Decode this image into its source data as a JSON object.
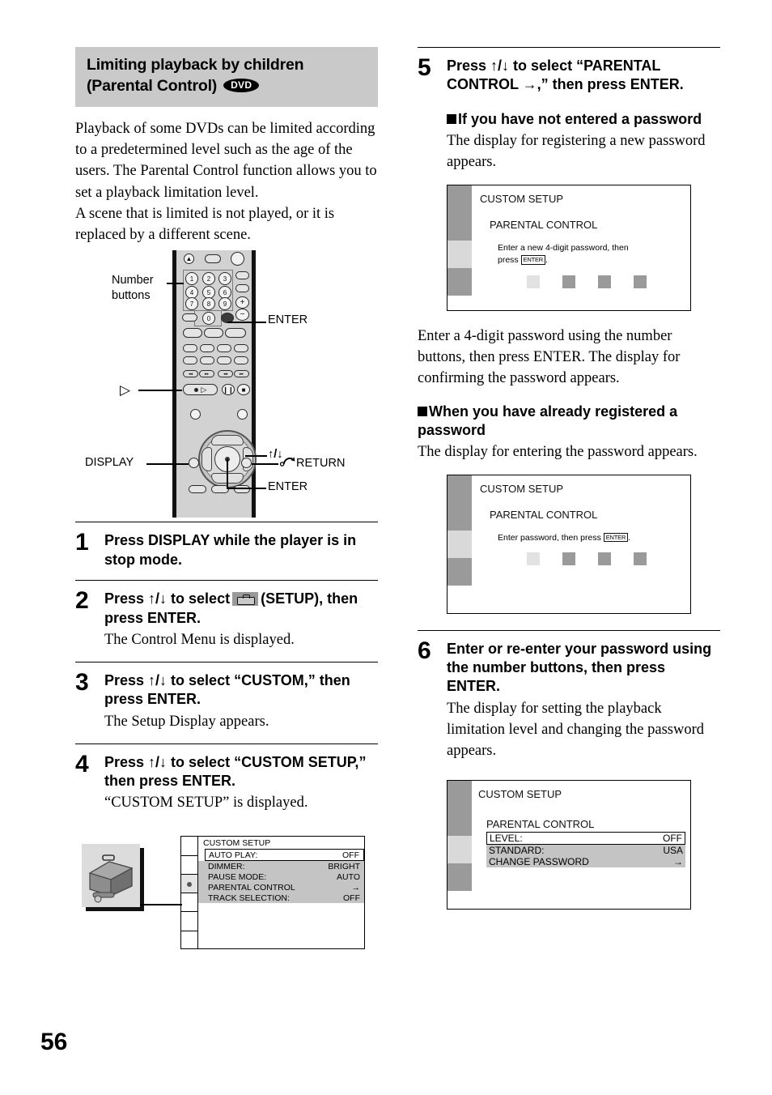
{
  "page_number": "56",
  "section": {
    "title_line1": "Limiting playback by children",
    "title_line2": "(Parental Control)",
    "badge": "DVD",
    "paragraphs": [
      "Playback of some DVDs can be limited according to a predetermined level such as the age of the users. The Parental Control function allows you to set a playback limitation level.",
      "A scene that is limited is not played, or it is replaced by a different scene."
    ]
  },
  "remote_figure": {
    "labels": {
      "number_buttons_l1": "Number",
      "number_buttons_l2": "buttons",
      "enter_top": "ENTER",
      "play": "▷",
      "updown": "↑/↓",
      "display": "DISPLAY",
      "return": "RETURN",
      "enter_bottom": "ENTER"
    },
    "numbers": [
      "1",
      "2",
      "3",
      "4",
      "5",
      "6",
      "7",
      "8",
      "9",
      "0"
    ],
    "volume_plus": "+",
    "volume_minus": "−"
  },
  "steps_left": [
    {
      "num": "1",
      "head": "Press DISPLAY while the player is in stop mode.",
      "sub": ""
    },
    {
      "num": "2",
      "head_before": "Press ↑/↓ to select",
      "head_after": "(SETUP), then press ENTER.",
      "icon": "setup-toolbox-icon",
      "sub": "The Control Menu is displayed."
    },
    {
      "num": "3",
      "head": "Press ↑/↓ to select “CUSTOM,” then press ENTER.",
      "sub": "The Setup Display appears."
    },
    {
      "num": "4",
      "head": "Press ↑/↓ to select “CUSTOM SETUP,” then press ENTER.",
      "sub": "“CUSTOM SETUP” is displayed."
    }
  ],
  "custom_setup_menu": {
    "title": "CUSTOM SETUP",
    "rows": [
      {
        "label": "AUTO PLAY:",
        "value": "OFF",
        "style": "boxed"
      },
      {
        "label": "DIMMER:",
        "value": "BRIGHT",
        "style": "highlight"
      },
      {
        "label": "PAUSE MODE:",
        "value": "AUTO",
        "style": "highlight"
      },
      {
        "label": "PARENTAL CONTROL",
        "value": "→",
        "style": "highlight"
      },
      {
        "label": "TRACK SELECTION:",
        "value": "OFF",
        "style": "highlight"
      }
    ]
  },
  "steps_right": [
    {
      "num": "5",
      "head": "Press ↑/↓ to select “PARENTAL CONTROL →,” then press ENTER."
    },
    {
      "num": "6",
      "head": "Enter or re-enter your password using the number buttons, then press ENTER.",
      "sub": "The display for setting the playback limitation level and changing the password appears."
    }
  ],
  "right_sections": {
    "subhead_1": "If you have not entered a password",
    "body_1": "The display for registering a new password appears.",
    "body_2": "Enter a 4-digit password using the number buttons, then press ENTER. The display for confirming the password appears.",
    "subhead_2": "When you have already registered a password",
    "body_3": "The display for entering the password appears."
  },
  "osd_new_password": {
    "title": "CUSTOM SETUP",
    "subtitle": "PARENTAL CONTROL",
    "hint_line1": "Enter a new 4-digit password, then",
    "hint_press": "press",
    "hint_key": "ENTER",
    "hint_end": "."
  },
  "osd_enter_password": {
    "title": "CUSTOM SETUP",
    "subtitle": "PARENTAL CONTROL",
    "hint_line1": "Enter password, then press",
    "hint_key": "ENTER",
    "hint_end": "."
  },
  "osd_parental_settings": {
    "title": "CUSTOM SETUP",
    "subtitle": "PARENTAL CONTROL",
    "rows": [
      {
        "label": "LEVEL:",
        "value": "OFF",
        "style": "boxed"
      },
      {
        "label": "STANDARD:",
        "value": "USA",
        "style": "highlight"
      },
      {
        "label": "CHANGE PASSWORD",
        "value": "→",
        "style": "highlight"
      }
    ]
  },
  "colors": {
    "band_gray": "#c9c9c9",
    "menu_highlight": "#c4c4c4",
    "osd_rail_dark": "#9a9a9a",
    "osd_rail_light": "#d9d9d9",
    "pwbox_filled": "#9a9a9a",
    "pwbox_current": "#e2e2e2"
  }
}
